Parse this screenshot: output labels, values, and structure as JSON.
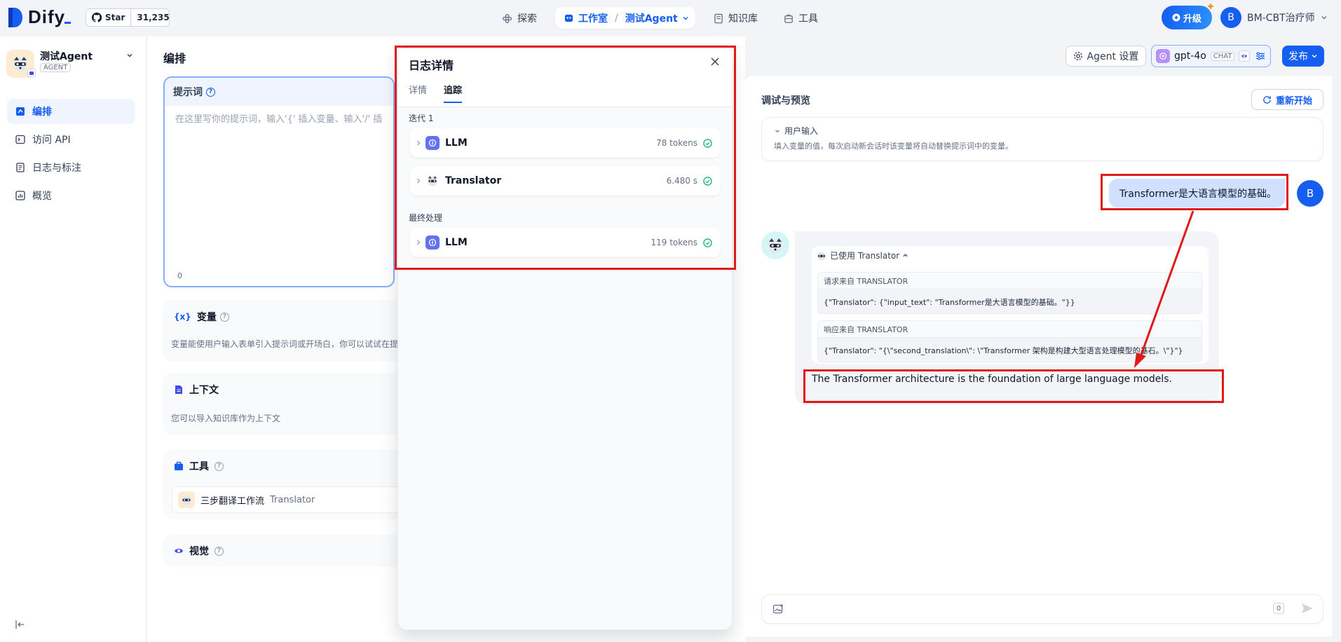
{
  "topbar": {
    "logo": "Dify",
    "github_star_label": "Star",
    "github_star_count": "31,235",
    "nav_explore": "探索",
    "nav_workspace": "工作室",
    "nav_current_app": "测试Agent",
    "nav_knowledge": "知识库",
    "nav_tools": "工具",
    "upgrade_label": "升级",
    "user_initial": "B",
    "user_name": "BM-CBT治疗师"
  },
  "sidebar": {
    "app_name": "测试Agent",
    "app_type": "AGENT",
    "items": [
      {
        "label": "编排",
        "icon": "layout-icon",
        "active": true
      },
      {
        "label": "访问 API",
        "icon": "terminal-icon",
        "active": false
      },
      {
        "label": "日志与标注",
        "icon": "file-list-icon",
        "active": false
      },
      {
        "label": "概览",
        "icon": "chart-icon",
        "active": false
      }
    ]
  },
  "orchestrate": {
    "title": "编排",
    "prompt_label": "提示词",
    "prompt_placeholder": "在这里写你的提示词，输入'{' 插入变量、输入'/' 插",
    "prompt_char_count": "0",
    "variables_label": "变量",
    "variables_desc": "变量能使用户输入表单引入提示词或开场白，你可以试试在提",
    "context_label": "上下文",
    "context_desc": "您可以导入知识库作为上下文",
    "tools_label": "工具",
    "tool_name": "三步翻译工作流",
    "tool_id": "Translator",
    "vision_label": "视觉"
  },
  "log_panel": {
    "title": "日志详情",
    "tab_detail": "详情",
    "tab_trace": "追踪",
    "iteration_label": "迭代 1",
    "final_label": "最终处理",
    "iteration_items": [
      {
        "name": "LLM",
        "value": "78 tokens",
        "icon": "llm-icon"
      },
      {
        "name": "Translator",
        "value": "6.480 s",
        "icon": "translator-icon"
      }
    ],
    "final_items": [
      {
        "name": "LLM",
        "value": "119 tokens",
        "icon": "llm-icon"
      }
    ]
  },
  "header_right": {
    "agent_settings": "Agent 设置",
    "model_name": "gpt-4o",
    "model_badge": "CHAT",
    "publish": "发布"
  },
  "debug": {
    "title": "调试与预览",
    "restart": "重新开始",
    "user_input_label": "用户输入",
    "user_input_desc": "填入变量的值，每次启动新会话时该变量将自动替换提示词中的变量。",
    "user_message": "Transformer是大语言模型的基础。",
    "user_initial": "B",
    "tool_used_label": "已使用 Translator",
    "request_label": "请求来自 TRANSLATOR",
    "request_body": "{\"Translator\": {\"input_text\": \"Transformer是大语言模型的基础。\"}}",
    "response_label": "响应来自 TRANSLATOR",
    "response_body": "{\"Translator\": \"{\\\"second_translation\\\": \\\"Transformer 架构是构建大型语言处理模型的基石。\\\"}\"}",
    "answer": "The Transformer architecture is the foundation of large language models.",
    "input_count": "0"
  },
  "colors": {
    "brand": "#155eef",
    "highlight": "#e01919",
    "success": "#12b76a"
  }
}
